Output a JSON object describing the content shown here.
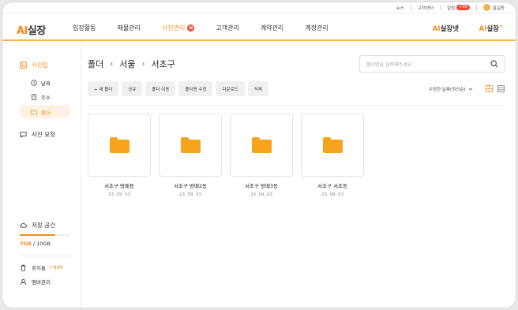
{
  "utility": {
    "news": "뉴스",
    "support": "고객센터",
    "alerts": "알림",
    "alert_count": "+99",
    "user": "홍길동"
  },
  "logo": {
    "ai": "AI",
    "name": "실장"
  },
  "menu": [
    {
      "label": "임장활동",
      "active": false
    },
    {
      "label": "매물관리",
      "active": false
    },
    {
      "label": "사진관리",
      "active": true,
      "badge": "N"
    },
    {
      "label": "고객관리",
      "active": false
    },
    {
      "label": "계약관리",
      "active": false
    },
    {
      "label": "계정관리",
      "active": false
    }
  ],
  "brands": {
    "b2_ai": "AI",
    "b2_name": "실장넷",
    "b3_ai": "AI",
    "b3_name": "실장",
    "b3_plus": "+"
  },
  "sidebar": {
    "photo": "사진첩",
    "subs": [
      "날짜",
      "주소",
      "폴더"
    ],
    "request": "사진 요청",
    "storage_title": "저장 공간",
    "storage_used": "7GB",
    "storage_total": " / 10GB",
    "storage_fraction": 0.7,
    "trash": "휴지통",
    "trash_count": "+999",
    "member": "멤버관리"
  },
  "breadcrumb": [
    "폴더",
    "서울",
    "서초구"
  ],
  "search": {
    "placeholder": "폴더명을 입력해주세요."
  },
  "toolbar": [
    "+ 새 폴더",
    "공유",
    "폴더 이동",
    "폴더명 수정",
    "다운로드",
    "삭제"
  ],
  "sort": "수정한 날짜(최신순)",
  "folders": [
    {
      "name": "서초구 방배동",
      "date": "23. 09. 03"
    },
    {
      "name": "서초구 방배2동",
      "date": "23. 09. 03"
    },
    {
      "name": "서초구 방배3동",
      "date": "23. 09. 03"
    },
    {
      "name": "서초구 서초동",
      "date": "23. 09. 03"
    }
  ],
  "colors": {
    "accent": "#f28c1e",
    "folder": "#f7a41d",
    "badge": "#f04a3a"
  }
}
